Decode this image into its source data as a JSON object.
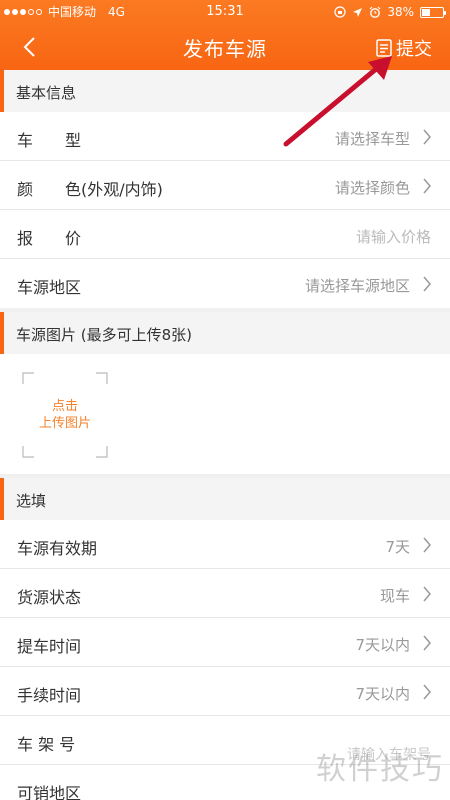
{
  "status_bar": {
    "carrier": "中国移动",
    "network": "4G",
    "time": "15:31",
    "battery": "38%",
    "battery_level": 0.38
  },
  "nav": {
    "title": "发布车源",
    "submit_label": "提交"
  },
  "sections": {
    "basic": {
      "title": "基本信息",
      "rows": [
        {
          "label": "车　　型",
          "value": "请选择车型"
        },
        {
          "label": "颜　　色(外观/内饰)",
          "value": "请选择颜色"
        },
        {
          "label": "报　　价",
          "value": "请输入价格"
        },
        {
          "label": "车源地区",
          "value": "请选择车源地区"
        }
      ]
    },
    "photos": {
      "title": "车源图片 (最多可上传8张)",
      "upload_line1": "点击",
      "upload_line2": "上传图片"
    },
    "optional": {
      "title": "选填",
      "rows": [
        {
          "label": "车源有效期",
          "value": "7天"
        },
        {
          "label": "货源状态",
          "value": "现车"
        },
        {
          "label": "提车时间",
          "value": "7天以内"
        },
        {
          "label": "手续时间",
          "value": "7天以内"
        },
        {
          "label": "车 架 号",
          "value": "请输入车架号"
        },
        {
          "label": "可销地区",
          "value": ""
        }
      ]
    }
  },
  "watermark": "软件技巧",
  "colors": {
    "accent": "#f86513",
    "annotation_arrow": "#c8102e"
  }
}
